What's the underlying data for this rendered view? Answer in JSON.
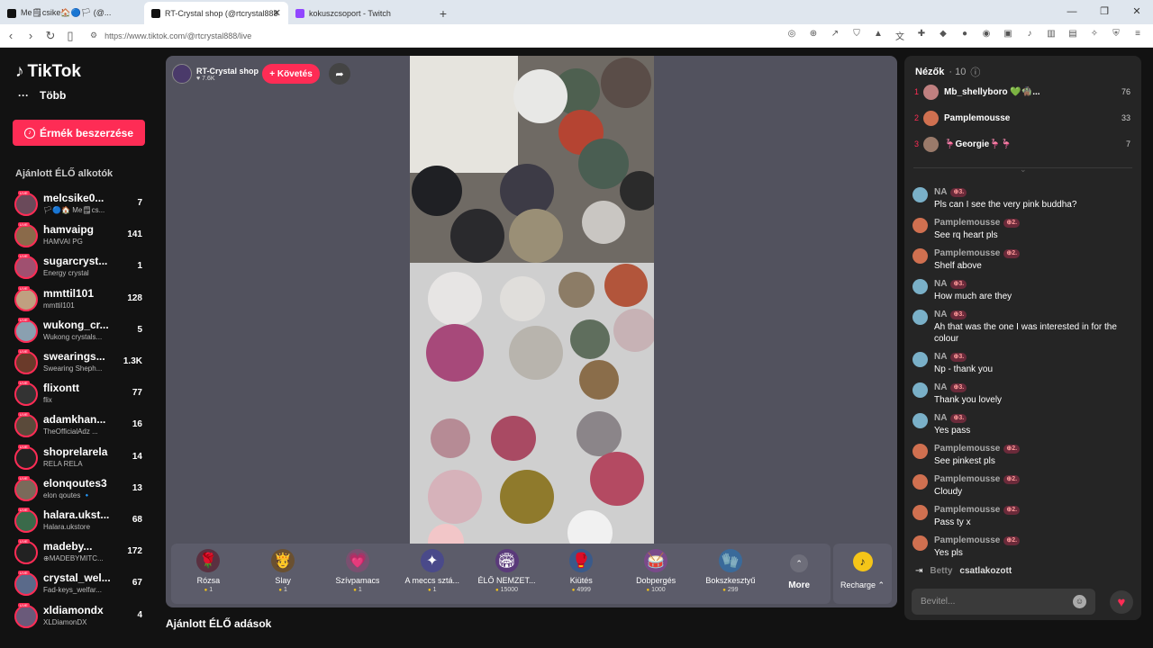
{
  "browser": {
    "tabs": [
      {
        "label": "Me🗒csike🏠🔵🏳 (@..."
      },
      {
        "label": "RT-Crystal shop (@rtcrystal888"
      },
      {
        "label": "kokuszcsoport - Twitch"
      }
    ],
    "url": "https://www.tiktok.com/@rtcrystal888/live"
  },
  "sidebar": {
    "logo": "TikTok",
    "more": "Több",
    "coins_button": "Érmék beszerzése",
    "recommended_title": "Ajánlott ÉLŐ alkotók",
    "creators": [
      {
        "name": "melcsike0...",
        "sub": "🏳🔵🏠 Me🗒cs...",
        "count": "7",
        "color": "#6a4a5a"
      },
      {
        "name": "hamvaipg",
        "sub": "HAMVAI PG",
        "count": "141",
        "color": "#8a6a4a"
      },
      {
        "name": "sugarcryst...",
        "sub": "Energy crystal",
        "count": "1",
        "color": "#a05070"
      },
      {
        "name": "mmttil101",
        "sub": "mmttil101",
        "count": "128",
        "color": "#c0a080"
      },
      {
        "name": "wukong_cr...",
        "sub": "Wukong crystals...",
        "count": "5",
        "color": "#8aa0b0"
      },
      {
        "name": "swearings...",
        "sub": "Swearing Sheph...",
        "count": "1.3K",
        "color": "#6a3a2a"
      },
      {
        "name": "flixontt",
        "sub": "flix",
        "count": "77",
        "color": "#333"
      },
      {
        "name": "adamkhan...",
        "sub": "TheOfficialAdz ...",
        "count": "16",
        "color": "#5a4a3a"
      },
      {
        "name": "shoprelarela",
        "sub": "RELA RELA",
        "count": "14",
        "color": "#222"
      },
      {
        "name": "elonqoutes3",
        "sub": "elon qoutes 🔹",
        "count": "13",
        "color": "#7a6a5a"
      },
      {
        "name": "halara.ukst...",
        "sub": "Halara.ukstore",
        "count": "68",
        "color": "#3a6a4a"
      },
      {
        "name": "madeby...",
        "sub": "⊕MADEBYMITC...",
        "count": "172",
        "color": "#222"
      },
      {
        "name": "crystal_wel...",
        "sub": "Fad-keys_welfar...",
        "count": "67",
        "color": "#5a6a8a"
      },
      {
        "name": "xldiamondx",
        "sub": "XLDiamonDX",
        "count": "4",
        "color": "#6a5a7a"
      }
    ]
  },
  "stream": {
    "host_name": "RT-Crystal shop",
    "host_likes": "♥ 7.6K",
    "follow_label": "+ Követés",
    "gifts": [
      {
        "name": "Rózsa",
        "price": "1",
        "icon": "🌹",
        "color": "#5a3040"
      },
      {
        "name": "Slay",
        "price": "1",
        "icon": "🫅",
        "color": "#6a5030"
      },
      {
        "name": "Szívpamacs",
        "price": "1",
        "icon": "💗",
        "color": "#7a5070"
      },
      {
        "name": "A meccs sztá...",
        "price": "1",
        "icon": "✦",
        "color": "#4a4a8a"
      },
      {
        "name": "ÉLŐ NEMZET...",
        "price": "15000",
        "icon": "🏟",
        "color": "#5a3a7a"
      },
      {
        "name": "Kiütés",
        "price": "4999",
        "icon": "🥊",
        "color": "#3a5a8a"
      },
      {
        "name": "Dobpergés",
        "price": "1000",
        "icon": "🥁",
        "color": "#7a4a8a"
      },
      {
        "name": "Bokszkesztyű",
        "price": "299",
        "icon": "🧤",
        "color": "#3a6a9a"
      }
    ],
    "more_label": "More",
    "recharge_label": "Recharge ⌃"
  },
  "below": {
    "title": "Ajánlott ÉLŐ adások"
  },
  "chat": {
    "viewers_label": "Nézők",
    "viewers_count": "· 10",
    "top_viewers": [
      {
        "rank": "1",
        "name": "Mb_shellyboro 💚🧌...",
        "score": "76",
        "color": "#c08080"
      },
      {
        "rank": "2",
        "name": "Pamplemousse",
        "score": "33",
        "color": "#d07050"
      },
      {
        "rank": "3",
        "name": "🦩Georgie🦩🦩",
        "score": "7",
        "color": "#9a7a6a"
      }
    ],
    "messages": [
      {
        "user": "NA",
        "badge": "⊕3.",
        "text": "Pls can I see the very pink buddha?",
        "color": "#7ab0c8"
      },
      {
        "user": "Pamplemousse",
        "badge": "⊕2.",
        "text": "See rq heart pls",
        "color": "#d07050"
      },
      {
        "user": "Pamplemousse",
        "badge": "⊕2.",
        "text": "Shelf above",
        "color": "#d07050"
      },
      {
        "user": "NA",
        "badge": "⊕3.",
        "text": "How much are they",
        "color": "#7ab0c8"
      },
      {
        "user": "NA",
        "badge": "⊕3.",
        "text": "Ah that was the one I was interested in for the colour",
        "color": "#7ab0c8"
      },
      {
        "user": "NA",
        "badge": "⊕3.",
        "text": "Np - thank you",
        "color": "#7ab0c8"
      },
      {
        "user": "NA",
        "badge": "⊕3.",
        "text": "Thank you lovely",
        "color": "#7ab0c8"
      },
      {
        "user": "NA",
        "badge": "⊕3.",
        "text": "Yes pass",
        "color": "#7ab0c8"
      },
      {
        "user": "Pamplemousse",
        "badge": "⊕2.",
        "text": "See pinkest pls",
        "color": "#d07050"
      },
      {
        "user": "Pamplemousse",
        "badge": "⊕2.",
        "text": "Cloudy",
        "color": "#d07050"
      },
      {
        "user": "Pamplemousse",
        "badge": "⊕2.",
        "text": "Pass ty x",
        "color": "#d07050"
      },
      {
        "user": "Pamplemousse",
        "badge": "⊕2.",
        "text": "Yes pls",
        "color": "#d07050"
      }
    ],
    "joined_user": "Betty",
    "joined_text": "csatlakozott",
    "input_placeholder": "Bevitel..."
  }
}
